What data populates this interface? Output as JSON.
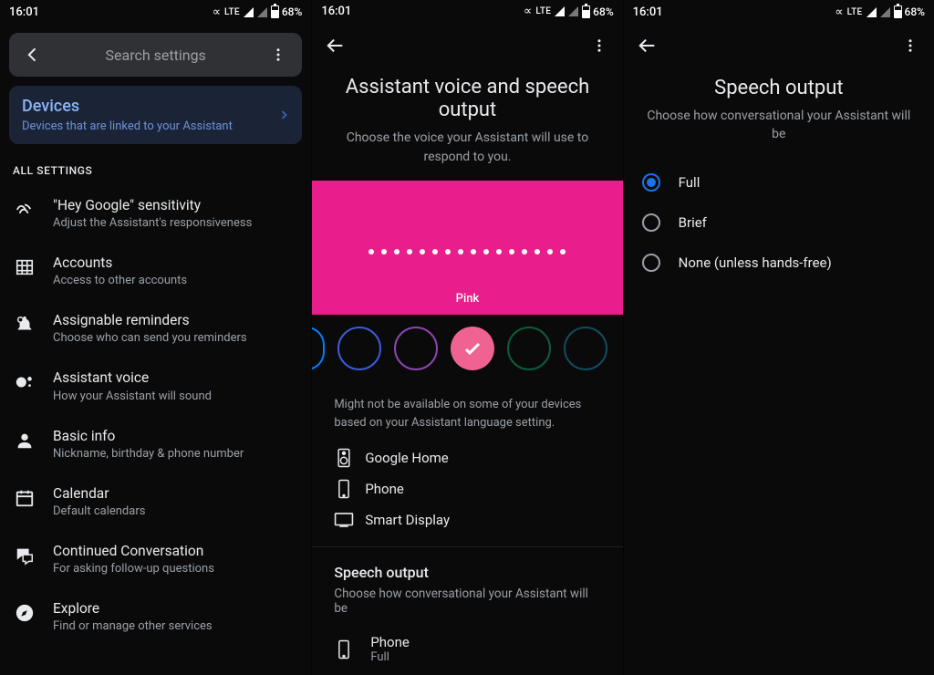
{
  "status": {
    "time": "16:01",
    "lte": "LTE",
    "battery": "68%"
  },
  "screen1": {
    "search_placeholder": "Search settings",
    "devices": {
      "title": "Devices",
      "subtitle": "Devices that are linked to your Assistant"
    },
    "all_settings_header": "ALL SETTINGS",
    "items": [
      {
        "title": "\"Hey Google\" sensitivity",
        "subtitle": "Adjust the Assistant's responsiveness"
      },
      {
        "title": "Accounts",
        "subtitle": "Access to other accounts"
      },
      {
        "title": "Assignable reminders",
        "subtitle": "Choose who can send you reminders"
      },
      {
        "title": "Assistant voice",
        "subtitle": "How your Assistant will sound"
      },
      {
        "title": "Basic info",
        "subtitle": "Nickname, birthday & phone number"
      },
      {
        "title": "Calendar",
        "subtitle": "Default calendars"
      },
      {
        "title": "Continued Conversation",
        "subtitle": "For asking follow-up questions"
      },
      {
        "title": "Explore",
        "subtitle": "Find or manage other services"
      }
    ]
  },
  "screen2": {
    "title": "Assistant voice and speech output",
    "desc": "Choose the voice your Assistant will use to respond to you.",
    "hero_label": "Pink",
    "voice_colors": [
      "#0080ff",
      "#3b5bdb",
      "#8e44ad",
      "selected",
      "#0b5d3b",
      "#134b5f"
    ],
    "note": "Might not be available on some of your devices based on your Assistant language setting.",
    "devices": [
      {
        "label": "Google Home"
      },
      {
        "label": "Phone"
      },
      {
        "label": "Smart Display"
      }
    ],
    "speech": {
      "title": "Speech output",
      "desc": "Choose how conversational your Assistant will be",
      "phone_label": "Phone",
      "phone_value": "Full"
    }
  },
  "screen3": {
    "title": "Speech output",
    "desc": "Choose how conversational your Assistant will be",
    "options": [
      {
        "label": "Full",
        "selected": true
      },
      {
        "label": "Brief",
        "selected": false
      },
      {
        "label": "None (unless hands-free)",
        "selected": false
      }
    ]
  }
}
